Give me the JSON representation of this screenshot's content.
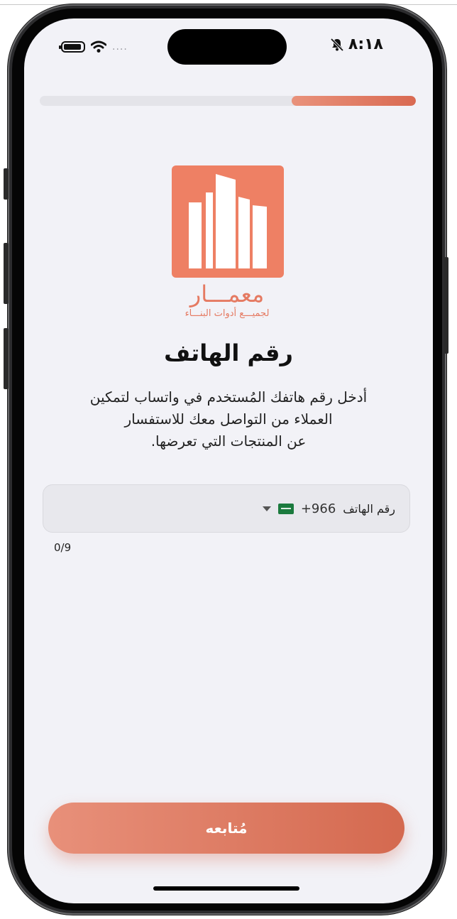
{
  "status_bar": {
    "time": "٨:١٨",
    "signal_dots": "....",
    "icons": [
      "battery-icon",
      "wifi-icon",
      "bell-slash-icon"
    ]
  },
  "progress": {
    "value": 0.33,
    "color": "#df7a62"
  },
  "brand": {
    "name": "معمـــار",
    "tagline": "لجميـــع أدوات البنـــاء",
    "color": "#ee8064"
  },
  "page": {
    "title": "رقم الهاتف",
    "description_lines": [
      "أدخل رقم هاتفك المُستخدم في واتساب لتمكين",
      "العملاء من التواصل معك للاستفسار",
      "عن المنتجات التي تعرضها."
    ]
  },
  "phone_input": {
    "country_flag": "saudi-flag-icon",
    "dial_code": "+966",
    "label": "رقم الهاتف",
    "value": "",
    "counter": "0/9"
  },
  "continue_button": {
    "label": "مُتابعه",
    "color": "#db7359"
  }
}
